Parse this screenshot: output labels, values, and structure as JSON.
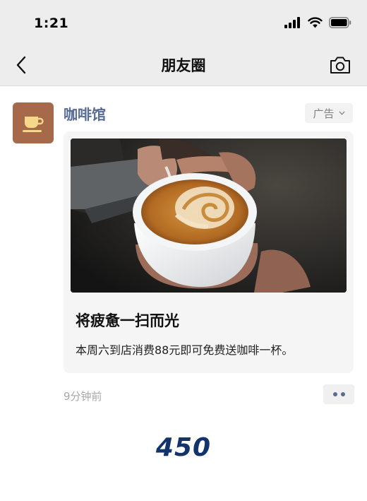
{
  "status_bar": {
    "time": "1:21"
  },
  "nav": {
    "title": "朋友圈"
  },
  "post": {
    "author": "咖啡馆",
    "ad_label": "广告",
    "card_title": "将疲惫一扫而光",
    "card_description": "本周六到店消费88元即可免费送咖啡一杯。",
    "time": "9分钟前"
  },
  "overlay_number": "450",
  "icons": [
    "cellular-signal-icon",
    "wifi-icon",
    "battery-icon",
    "back-arrow-icon",
    "camera-icon",
    "coffee-cup-icon",
    "chevron-down-icon",
    "more-dots-icon"
  ],
  "colors": {
    "link": "#576b95",
    "nav_bg": "#ededed",
    "avatar_bg": "#a66a4b",
    "overlay": "#12336b"
  }
}
